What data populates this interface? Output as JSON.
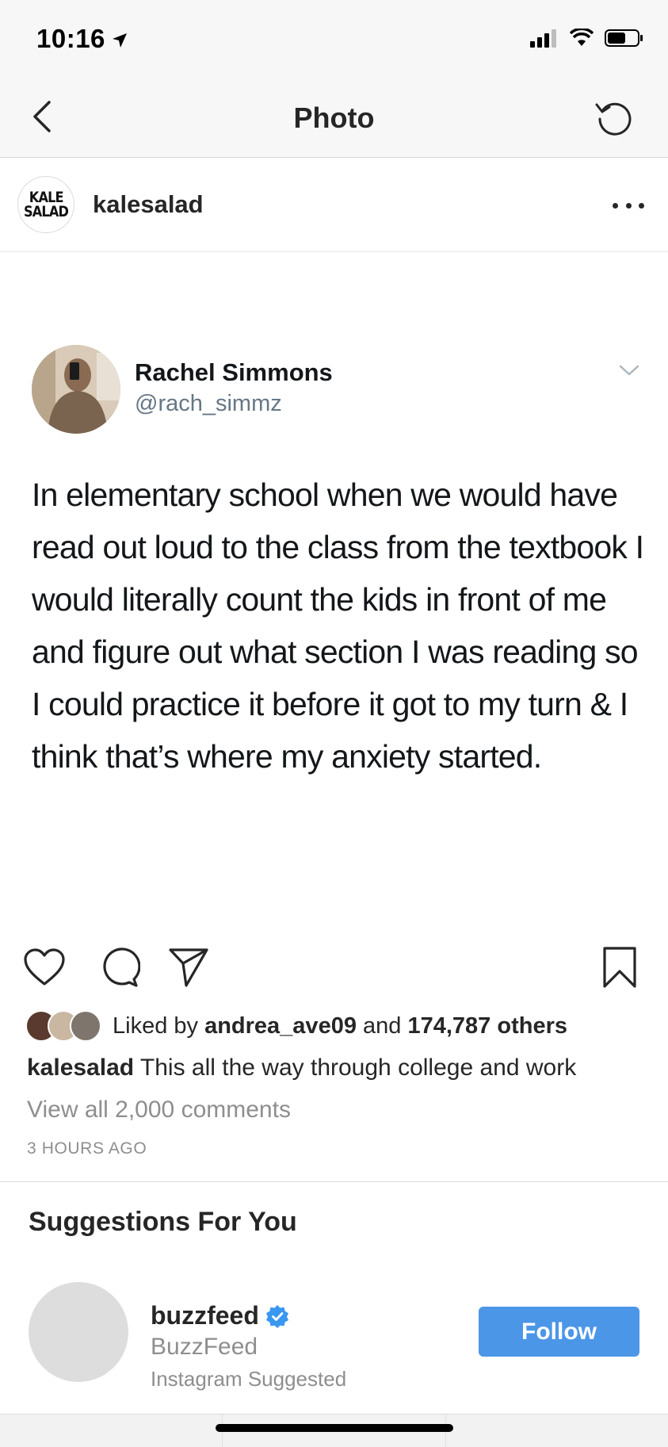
{
  "status_bar": {
    "time": "10:16"
  },
  "nav": {
    "title": "Photo"
  },
  "post": {
    "username": "kalesalad",
    "avatar_text_top": "KALE",
    "avatar_text_bottom": "SALAD"
  },
  "photo": {
    "tweet": {
      "name": "Rachel Simmons",
      "handle": "@rach_simmz",
      "text": "In elementary school when we would have read out loud to the class from the textbook I would literally count the kids in front of me and figure out what section I was reading so I could practice it before it got to my turn & I think that’s where my anxiety started."
    }
  },
  "engagement": {
    "liked_by_prefix": "Liked by",
    "liked_by_user": "andrea_ave09",
    "liked_by_and": "and",
    "liked_by_others": "174,787 others",
    "caption_user": "kalesalad",
    "caption_text": "This all the way through college and work",
    "view_comments": "View all 2,000 comments",
    "timestamp": "3 HOURS AGO"
  },
  "suggestions": {
    "title": "Suggestions For You",
    "items": [
      {
        "username": "buzzfeed",
        "name": "BuzzFeed",
        "reason": "Instagram Suggested",
        "follow_label": "Follow"
      }
    ]
  },
  "colors": {
    "accent": "#4c96e8",
    "verified": "#3897f0",
    "secondary_text": "#8e8e8e",
    "tweet_handle": "#657786"
  },
  "icons": {
    "back": "chevron-left-icon",
    "refresh": "refresh-icon",
    "more": "more-dots-icon",
    "like": "heart-icon",
    "comment": "comment-icon",
    "share": "direct-share-icon",
    "save": "bookmark-icon",
    "verified": "verified-badge-icon"
  }
}
